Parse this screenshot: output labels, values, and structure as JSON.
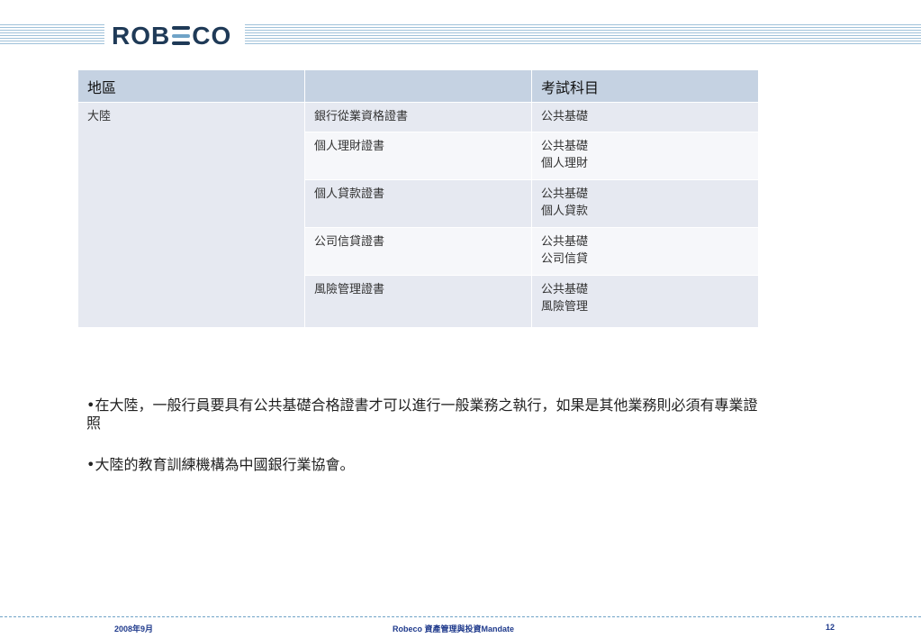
{
  "header": {
    "logo_text": "ROBECO"
  },
  "table": {
    "headers": [
      "地區",
      "",
      "考試科目"
    ],
    "region": "大陸",
    "rows": [
      {
        "certificate": "銀行從業資格證書",
        "subjects": [
          "公共基礎"
        ]
      },
      {
        "certificate": "個人理財證書",
        "subjects": [
          "公共基礎",
          "個人理財"
        ]
      },
      {
        "certificate": "個人貸款證書",
        "subjects": [
          "公共基礎",
          "個人貸款"
        ]
      },
      {
        "certificate": "公司信貸證書",
        "subjects": [
          "公共基礎",
          "公司信貸"
        ]
      },
      {
        "certificate": "風險管理證書",
        "subjects": [
          "公共基礎",
          "風險管理"
        ]
      }
    ]
  },
  "bullets": [
    "•在大陸，一般行員要具有公共基礎合格證書才可以進行一般業務之執行，如果是其他業務則必須有專業證照",
    "•大陸的教育訓練機構為中國銀行業協會。"
  ],
  "footer": {
    "date": "2008年9月",
    "title": "Robeco 資產管理與投資Mandate",
    "page": "12"
  }
}
